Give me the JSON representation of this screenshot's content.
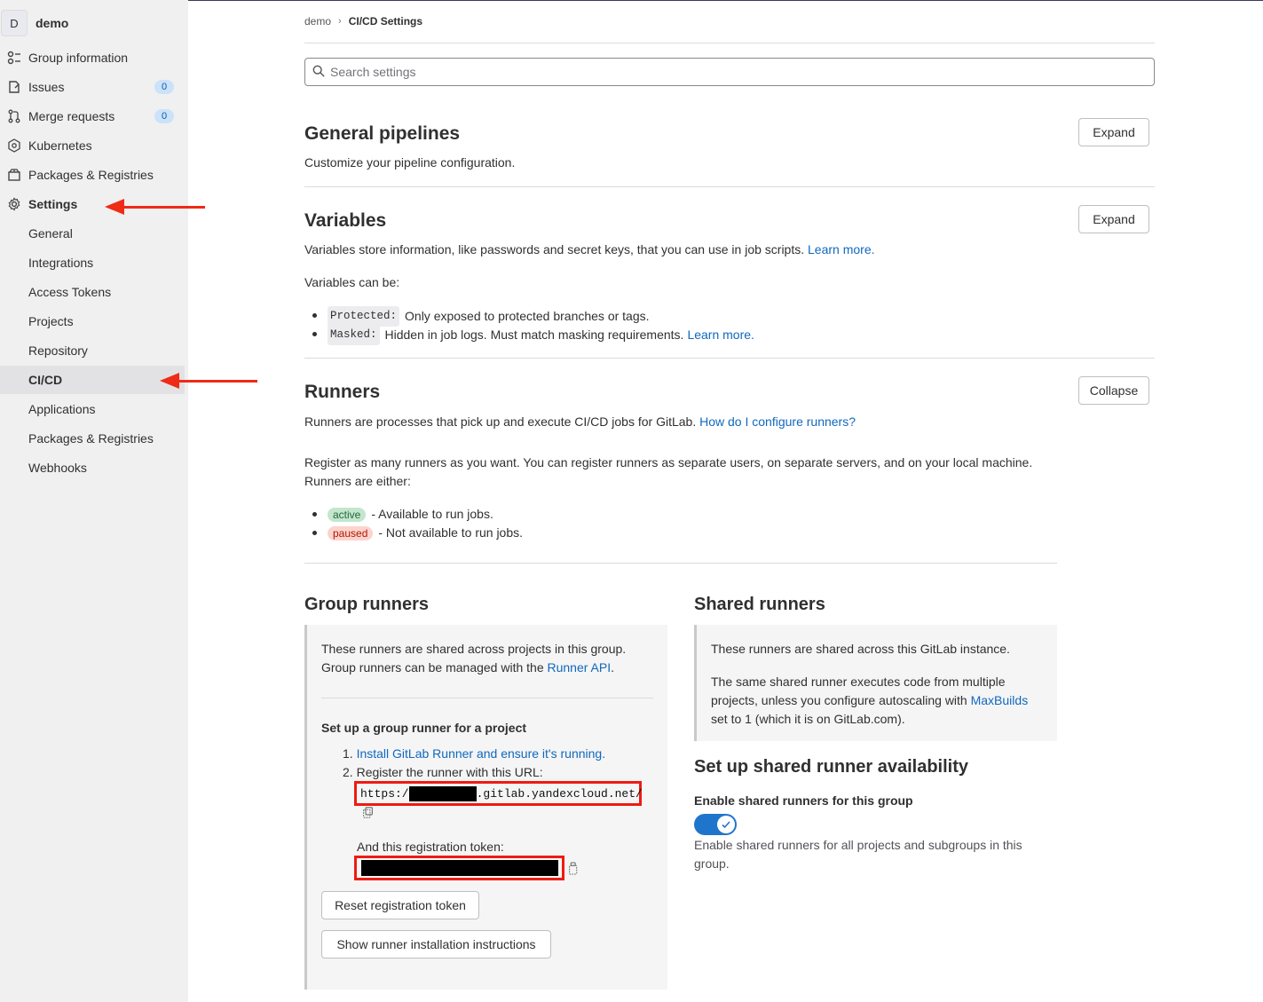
{
  "sidebar": {
    "avatar_letter": "D",
    "group_name": "demo",
    "items": [
      {
        "label": "Group information",
        "icon": "group-icon"
      },
      {
        "label": "Issues",
        "icon": "issues-icon",
        "badge": "0"
      },
      {
        "label": "Merge requests",
        "icon": "merge-request-icon",
        "badge": "0"
      },
      {
        "label": "Kubernetes",
        "icon": "kubernetes-icon"
      },
      {
        "label": "Packages & Registries",
        "icon": "package-icon"
      },
      {
        "label": "Settings",
        "icon": "settings-icon"
      }
    ],
    "settings_subitems": [
      "General",
      "Integrations",
      "Access Tokens",
      "Projects",
      "Repository",
      "CI/CD",
      "Applications",
      "Packages & Registries",
      "Webhooks"
    ],
    "active_subitem": "CI/CD"
  },
  "breadcrumb": {
    "parent": "demo",
    "current": "CI/CD Settings"
  },
  "search": {
    "placeholder": "Search settings"
  },
  "general_pipelines": {
    "title": "General pipelines",
    "description": "Customize your pipeline configuration.",
    "button": "Expand"
  },
  "variables": {
    "title": "Variables",
    "description": "Variables store information, like passwords and secret keys, that you can use in job scripts.",
    "learn_more": "Learn more.",
    "can_be": "Variables can be:",
    "protected_code": "Protected:",
    "protected_text": "Only exposed to protected branches or tags.",
    "masked_code": "Masked:",
    "masked_text": "Hidden in job logs. Must match masking requirements.",
    "masked_link": "Learn more.",
    "button": "Expand"
  },
  "runners": {
    "title": "Runners",
    "description": "Runners are processes that pick up and execute CI/CD jobs for GitLab.",
    "configure_link": "How do I configure runners?",
    "register_line1": "Register as many runners as you want. You can register runners as separate users, on separate servers, and on your local machine.",
    "register_line2": "Runners are either:",
    "active_pill": "active",
    "active_text": "- Available to run jobs.",
    "paused_pill": "paused",
    "paused_text": "- Not available to run jobs.",
    "button": "Collapse"
  },
  "group_runners": {
    "title": "Group runners",
    "line1": "These runners are shared across projects in this group.",
    "line2_prefix": "Group runners can be managed with the",
    "line2_link": "Runner API",
    "line2_suffix": ".",
    "setup_title": "Set up a group runner for a project",
    "step1_num": "1.",
    "step1_link": "Install GitLab Runner and ensure it's running.",
    "step2_num": "2.",
    "step2_text": "Register the runner with this URL:",
    "url_prefix": "https:/",
    "url_suffix": ".gitlab.yandexcloud.net/",
    "token_label": "And this registration token:",
    "reset_button": "Reset registration token",
    "instructions_button": "Show runner installation instructions"
  },
  "shared_runners": {
    "title": "Shared runners",
    "line1": "These runners are shared across this GitLab instance.",
    "line2": "The same shared runner executes code from multiple",
    "line3_prefix": "projects, unless you configure autoscaling with",
    "line3_link": "MaxBuilds",
    "line4": "set to 1 (which it is on GitLab.com).",
    "availability_title": "Set up shared runner availability",
    "toggle_label": "Enable shared runners for this group",
    "toggle_on": true,
    "toggle_help1": "Enable shared runners for all projects and subgroups in this",
    "toggle_help2": "group."
  },
  "colors": {
    "link": "#1068bf",
    "annotation_red": "#ee2b16",
    "toggle_blue": "#1f75cb"
  }
}
